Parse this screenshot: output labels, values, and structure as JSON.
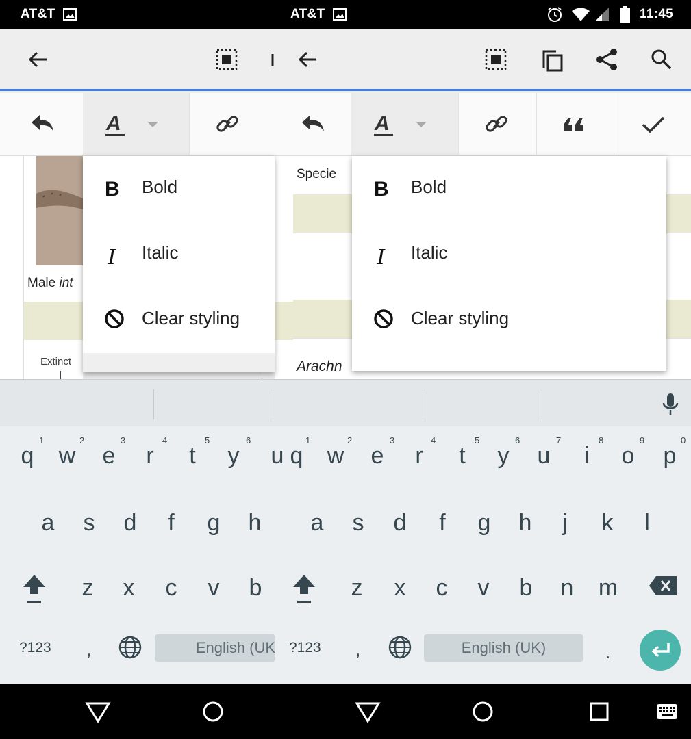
{
  "status_bar": {
    "carrier_left": "AT&T",
    "carrier_right": "AT&T",
    "time": "11:45",
    "icons": [
      "image-icon",
      "alarm-icon",
      "wifi-icon",
      "signal-icon",
      "battery-icon"
    ]
  },
  "toolbar": {
    "icons": [
      "back-arrow-icon",
      "select-all-icon",
      "copy-icon",
      "share-icon",
      "search-icon"
    ]
  },
  "edit_toolbar": {
    "icons": [
      "undo-icon",
      "text-style-icon",
      "dropdown-caret-icon",
      "link-icon",
      "quote-icon",
      "check-icon"
    ]
  },
  "format_menu": {
    "items": [
      {
        "icon": "bold-icon",
        "label": "Bold"
      },
      {
        "icon": "italic-icon",
        "label": "Italic"
      },
      {
        "icon": "clear-styling-icon",
        "label": "Clear styling"
      }
    ]
  },
  "article_left": {
    "caption_prefix": "Male ",
    "caption_italic": "int",
    "chart_label": "Extinct"
  },
  "article_right": {
    "label": "Specie",
    "italic_text": "Arachn"
  },
  "keyboard": {
    "row1": [
      "q",
      "w",
      "e",
      "r",
      "t",
      "y",
      "u",
      "i",
      "o",
      "p"
    ],
    "row1_numbers": [
      "1",
      "2",
      "3",
      "4",
      "5",
      "6",
      "7",
      "8",
      "9",
      "0"
    ],
    "row2": [
      "a",
      "s",
      "d",
      "f",
      "g",
      "h",
      "j",
      "k",
      "l"
    ],
    "row3": [
      "z",
      "x",
      "c",
      "v",
      "b",
      "n",
      "m"
    ],
    "symbols_key": "?123",
    "comma": ",",
    "period": ".",
    "spacebar_left": "English (UK",
    "spacebar_right": "English (UK)",
    "accent_color": "#4db6ac"
  },
  "nav_bar": {
    "icons": [
      "back-triangle-icon",
      "home-circle-icon",
      "recents-square-icon",
      "keyboard-icon"
    ]
  }
}
